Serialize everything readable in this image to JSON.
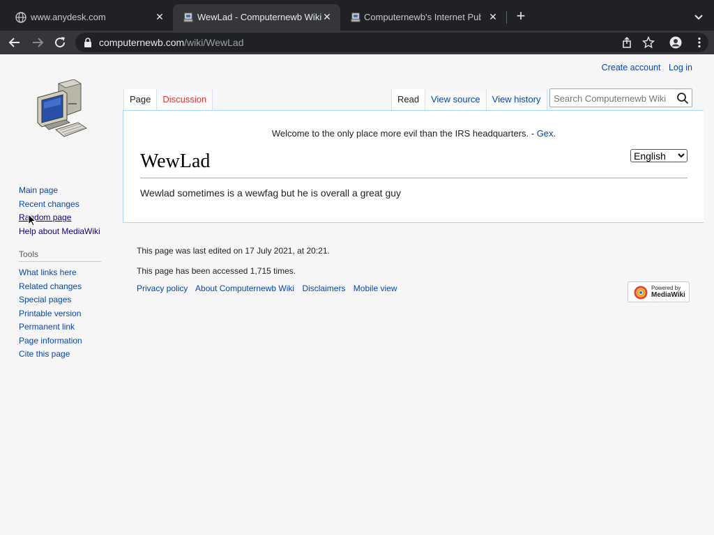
{
  "browser": {
    "tabs": [
      {
        "title": "www.anydesk.com",
        "active": false
      },
      {
        "title": "WewLad - Computernewb Wiki",
        "active": true
      },
      {
        "title": "Computernewb's Internet Pub",
        "active": false
      }
    ],
    "close_glyph": "✕",
    "new_tab_glyph": "+",
    "url_host": "computernewb.com",
    "url_path": "/wiki/WewLad"
  },
  "personal": {
    "create_account": "Create account",
    "log_in": "Log in"
  },
  "sidebar": {
    "navigation": [
      "Main page",
      "Recent changes",
      "Random page",
      "Help about MediaWiki"
    ],
    "tools_heading": "Tools",
    "tools": [
      "What links here",
      "Related changes",
      "Special pages",
      "Printable version",
      "Permanent link",
      "Page information",
      "Cite this page"
    ]
  },
  "page_tabs": {
    "page": "Page",
    "discussion": "Discussion",
    "read": "Read",
    "view_source": "View source",
    "view_history": "View history"
  },
  "search": {
    "placeholder": "Search Computernewb Wiki"
  },
  "content": {
    "sitenotice_text": "Welcome to the only place more evil than the IRS headquarters. - ",
    "sitenotice_link": "Gex",
    "sitenotice_end": ".",
    "language_selected": "English",
    "title": "WewLad",
    "body": "Wewlad sometimes is a wewfag but he is overall a great guy"
  },
  "footer": {
    "last_edited": "This page was last edited on 17 July 2021, at 20:21.",
    "accessed": "This page has been accessed 1,715 times.",
    "links": [
      "Privacy policy",
      "About Computernewb Wiki",
      "Disclaimers",
      "Mobile view"
    ],
    "powered_line1": "Powered by",
    "powered_line2": "MediaWiki"
  },
  "colors": {
    "link": "#0645ad",
    "new_link": "#dd3333",
    "tab_border": "#a7d7f9",
    "chrome_dark": "#202124",
    "chrome_toolbar": "#35363a"
  }
}
